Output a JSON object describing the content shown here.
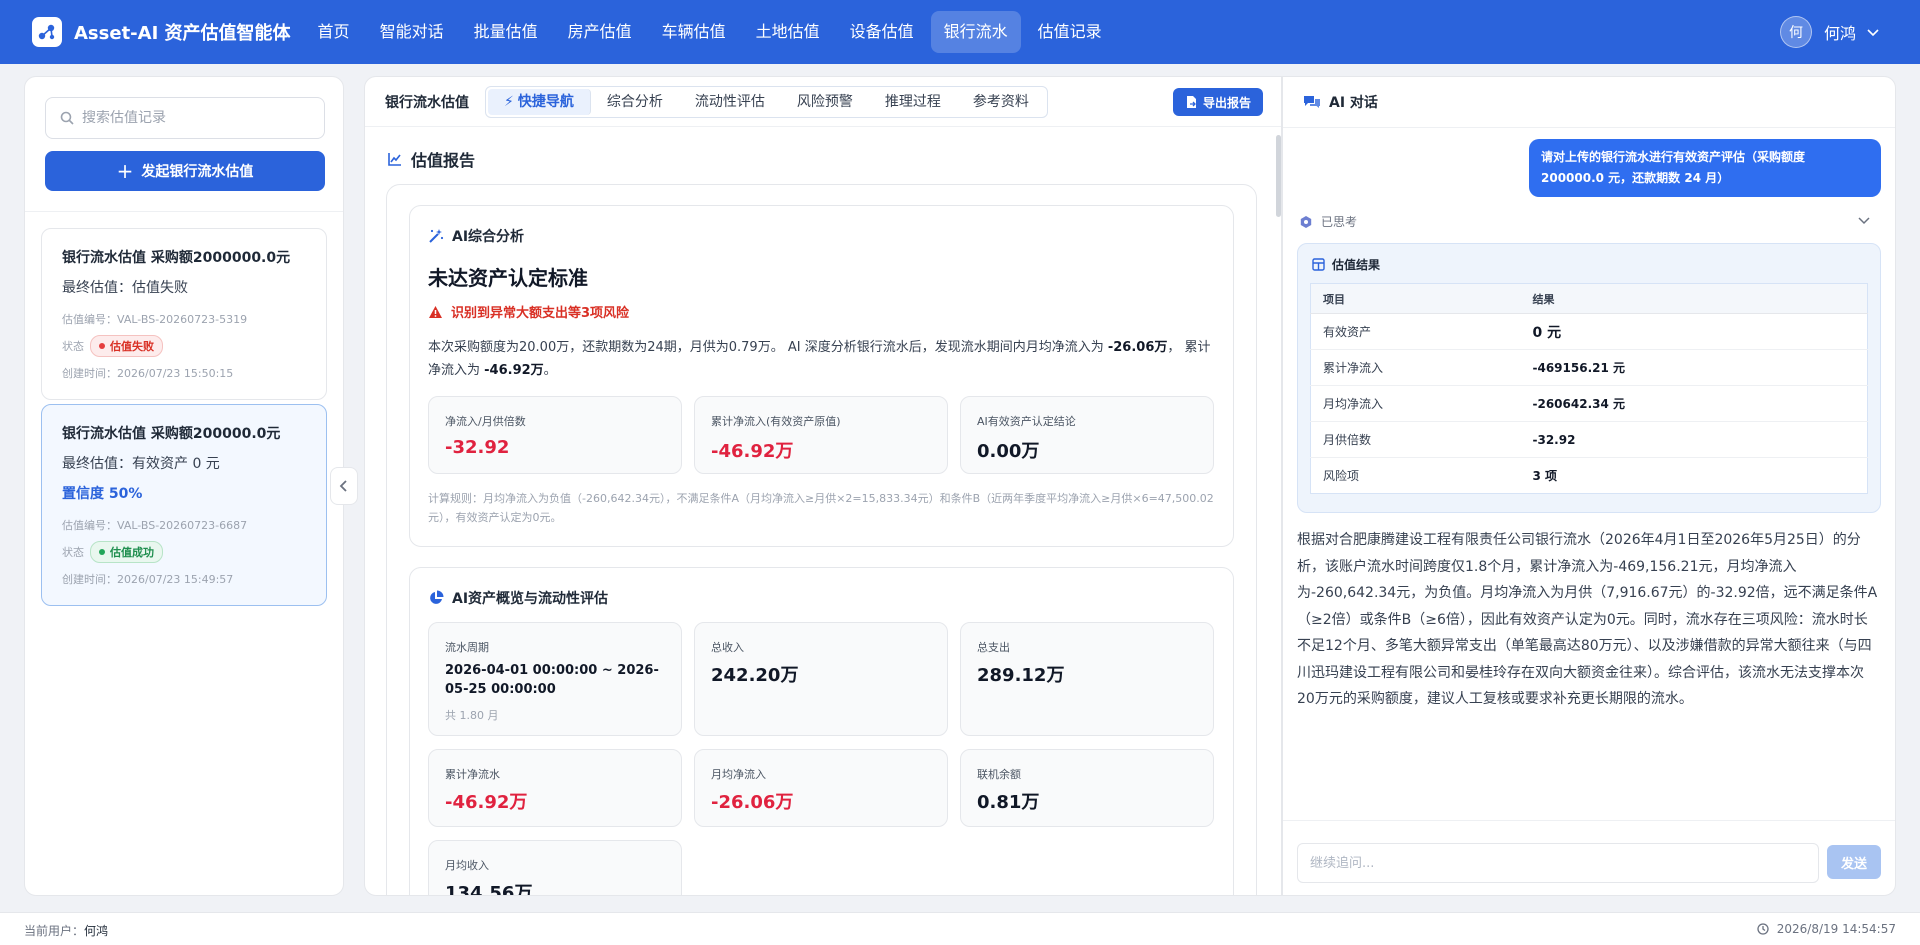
{
  "app": {
    "title": "Asset-AI 资产估值智能体"
  },
  "nav": {
    "items": [
      "首页",
      "智能对话",
      "批量估值",
      "房产估值",
      "车辆估值",
      "土地估值",
      "设备估值",
      "银行流水",
      "估值记录"
    ],
    "active_index": 7
  },
  "user": {
    "avatar_text": "何",
    "name": "何鸿"
  },
  "sidebar": {
    "search_placeholder": "搜索估值记录",
    "new_button_label": "发起银行流水估值",
    "records": [
      {
        "title": "银行流水估值 采购额2000000.0元",
        "result": "最终估值：估值失败",
        "id_label": "估值编号：VAL-BS-20260723-5319",
        "status_label": "状态",
        "status": "估值失败",
        "created": "创建时间：2026/07/23 15:50:15"
      },
      {
        "title": "银行流水估值 采购额200000.0元",
        "result": "最终估值：有效资产 0 元",
        "confidence": "置信度 50%",
        "id_label": "估值编号：VAL-BS-20260723-6687",
        "status_label": "状态",
        "status": "估值成功",
        "created": "创建时间：2026/07/23 15:49:57"
      }
    ]
  },
  "main": {
    "title": "银行流水估值",
    "tabs": [
      "快捷导航",
      "综合分析",
      "流动性评估",
      "风险预警",
      "推理过程",
      "参考资料"
    ],
    "active_tab": 0,
    "export_label": "导出报告",
    "section_title": "估值报告",
    "analysis": {
      "heading": "AI综合分析",
      "conclusion": "未达资产认定标准",
      "risk": "识别到异常大额支出等3项风险",
      "desc_1": "本次采购额度为20.00万，还款期数为24期，月供为0.79万。 AI 深度分析银行流水后，发现流水期间内月均净流入为 ",
      "desc_b1": "-26.06万",
      "desc_2": "， 累计净流入为 ",
      "desc_b2": "-46.92万",
      "desc_3": "。",
      "metrics": [
        {
          "label": "净流入/月供倍数",
          "value": "-32.92"
        },
        {
          "label": "累计净流入(有效资产原值)",
          "value": "-46.92万"
        },
        {
          "label": "AI有效资产认定结论",
          "value": "0.00万"
        }
      ],
      "rule": "计算规则：月均净流入为负值（-260,642.34元），不满足条件A（月均净流入≥月供×2=15,833.34元）和条件B（近两年季度平均净流入≥月供×6=47,500.02元），有效资产认定为0元。"
    },
    "overview": {
      "heading": "AI资产概览与流动性评估",
      "items": [
        {
          "label": "流水周期",
          "value": "2026-04-01 00:00:00 ~ 2026-05-25 00:00:00",
          "sub": "共 1.80 月"
        },
        {
          "label": "总收入",
          "value": "242.20万"
        },
        {
          "label": "总支出",
          "value": "289.12万"
        },
        {
          "label": "累计净流水",
          "value": "-46.92万"
        },
        {
          "label": "月均净流入",
          "value": "-26.06万"
        },
        {
          "label": "联机余额",
          "value": "0.81万"
        },
        {
          "label": "月均收入",
          "value": "134.56万"
        }
      ]
    }
  },
  "chat": {
    "title": "AI 对话",
    "user_message": "请对上传的银行流水进行有效资产评估（采购额度 200000.0 元，还款期数 24 月）",
    "thought_label": "已思考",
    "result_title": "估值结果",
    "table": {
      "headers": [
        "项目",
        "结果"
      ],
      "rows": [
        [
          "有效资产",
          "0 元"
        ],
        [
          "累计净流入",
          "-469156.21 元"
        ],
        [
          "月均净流入",
          "-260642.34 元"
        ],
        [
          "月供倍数",
          "-32.92"
        ],
        [
          "风险项",
          "3 项"
        ]
      ]
    },
    "answer": "根据对合肥康腾建设工程有限责任公司银行流水（2026年4月1日至2026年5月25日）的分析，该账户流水时间跨度仅1.8个月，累计净流入为-469,156.21元，月均净流入为-260,642.34元，为负值。月均净流入为月供（7,916.67元）的-32.92倍，远不满足条件A（≥2倍）或条件B（≥6倍），因此有效资产认定为0元。同时，流水存在三项风险：流水时长不足12个月、多笔大额异常支出（单笔最高达80万元）、以及涉嫌借款的异常大额往来（与四川迅玛建设工程有限公司和晏桂玲存在双向大额资金往来）。综合评估，该流水无法支撑本次20万元的采购额度，建议人工复核或要求补充更长期限的流水。",
    "input_placeholder": "继续追问...",
    "send_label": "发送"
  },
  "footer": {
    "user_label": "当前用户：",
    "user_name": "何鸿",
    "datetime": "2026/8/19 14:54:57"
  },
  "colors": {
    "primary": "#2b63db",
    "negative": "#e0223f",
    "success": "#1e8e4e",
    "danger": "#d93025"
  }
}
